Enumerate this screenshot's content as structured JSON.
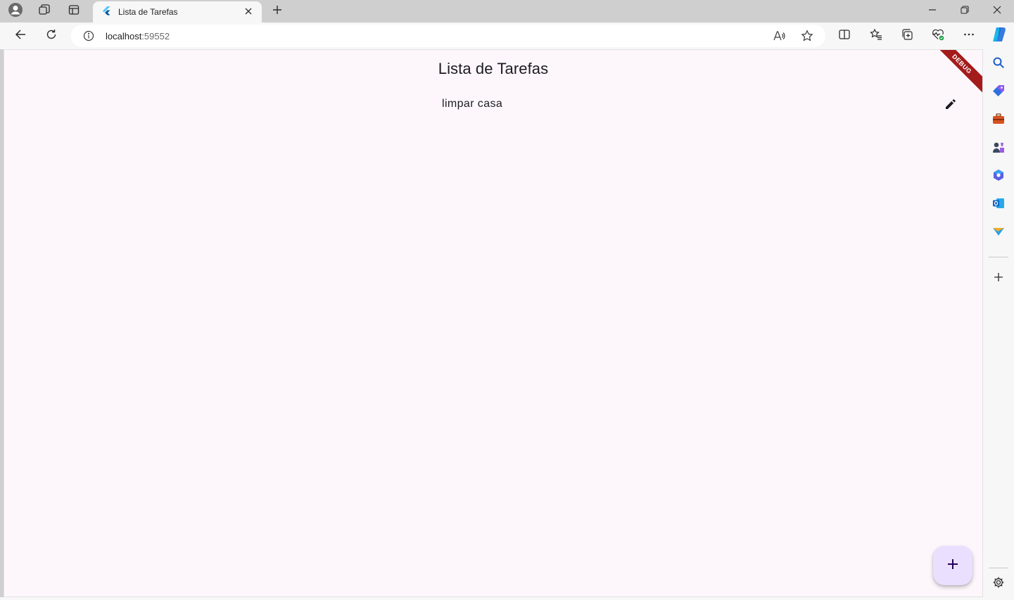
{
  "browser": {
    "tab": {
      "title": "Lista de Tarefas"
    },
    "address": {
      "host": "localhost",
      "port": ":59552"
    }
  },
  "app": {
    "title": "Lista de Tarefas",
    "debug_banner": "DEBUG",
    "tasks": [
      {
        "text": "limpar casa"
      }
    ]
  },
  "icons": {
    "profile": "profile-icon",
    "workspaces": "workspaces-icon",
    "vertical_tabs": "vertical-tabs-icon",
    "tab_favicon": "flutter-favicon-icon",
    "tab_close": "close-icon",
    "new_tab": "plus-icon",
    "minimize": "minimize-icon",
    "restore": "restore-icon",
    "window_close": "close-icon",
    "back": "back-arrow-icon",
    "refresh": "refresh-icon",
    "site_info": "info-icon",
    "read_aloud": "read-aloud-icon",
    "favorite": "star-icon",
    "split_screen": "split-screen-icon",
    "favorites": "favorites-icon",
    "collections": "collections-icon",
    "browser_essentials": "heart-pulse-icon",
    "more": "ellipsis-icon",
    "copilot": "copilot-icon",
    "edit": "pencil-icon",
    "add": "plus-icon",
    "sidebar": [
      "search-icon",
      "shopping-tag-icon",
      "tools-briefcase-icon",
      "games-icon",
      "m365-icon",
      "outlook-icon",
      "send-icon",
      "add-icon",
      "settings-icon"
    ]
  },
  "colors": {
    "page_background": "#fdf7fc",
    "fab_background": "#ebdfff",
    "fab_icon": "#21005d",
    "debug_banner": "#a41b1b",
    "text": "#1d1b20"
  }
}
